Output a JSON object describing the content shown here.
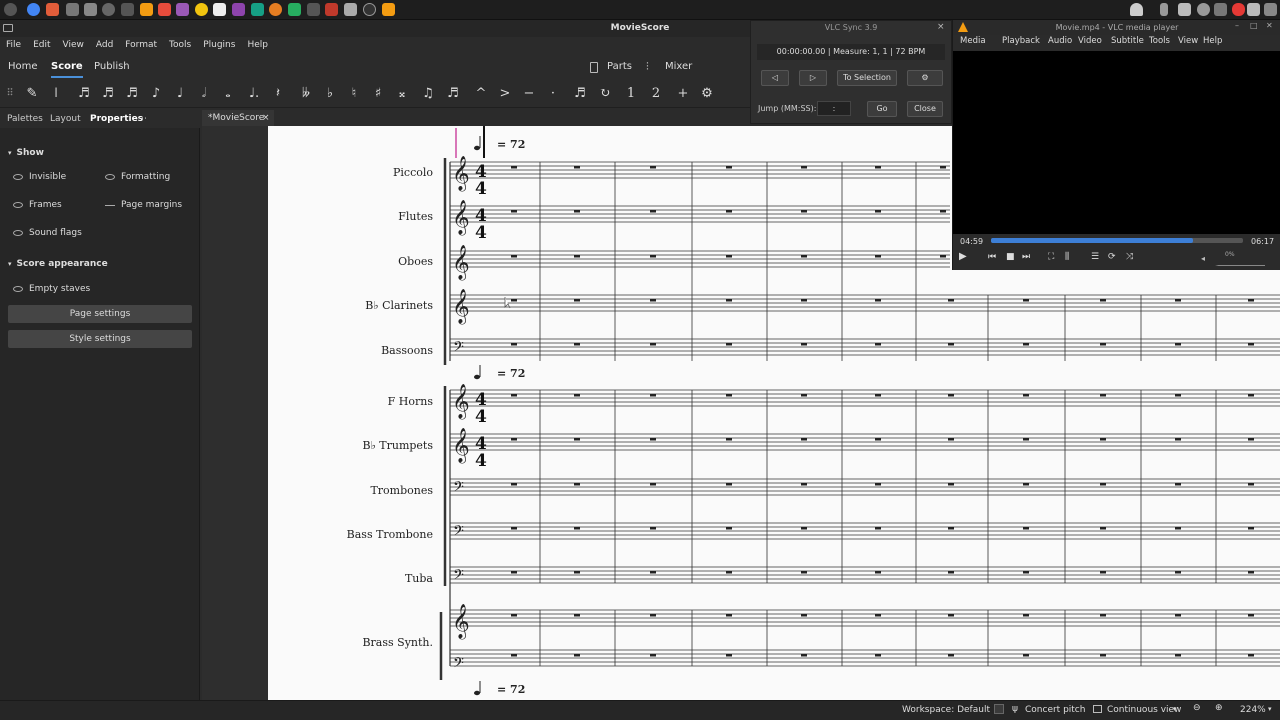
{
  "app": {
    "title": "MovieScore"
  },
  "menu": [
    "File",
    "Edit",
    "View",
    "Add",
    "Format",
    "Tools",
    "Plugins",
    "Help"
  ],
  "tabs": {
    "home": "Home",
    "score": "Score",
    "publish": "Publish",
    "parts": "Parts",
    "mixer": "Mixer"
  },
  "panel_tabs": {
    "palettes": "Palettes",
    "layout": "Layout",
    "properties": "Properties",
    "more": "⋯"
  },
  "properties": {
    "show_header": "Show",
    "invisible": "Invisible",
    "formatting": "Formatting",
    "frames": "Frames",
    "page_margins": "Page margins",
    "sound_flags": "Sound flags",
    "appearance_header": "Score appearance",
    "empty_staves": "Empty staves",
    "page_settings": "Page settings",
    "style_settings": "Style settings"
  },
  "document_tab": {
    "label": "*MovieScore",
    "close": "×"
  },
  "score": {
    "tempo_text": "= 72",
    "instruments": [
      "Piccolo",
      "Flutes",
      "Oboes",
      "B♭ Clarinets",
      "Bassoons",
      "F Horns",
      "B♭ Trumpets",
      "Trombones",
      "Bass Trombone",
      "Tuba",
      "Brass Synth."
    ]
  },
  "vlc_sync": {
    "title": "VLC Sync 3.9",
    "status": "00:00:00.00 | Measure: 1, 1 | 72 BPM",
    "to_selection": "To Selection",
    "jump_label": "Jump (MM:SS):",
    "jump_value": ":",
    "go": "Go",
    "close": "Close",
    "close_icon": "×"
  },
  "vlc_player": {
    "title": "Movie.mp4 - VLC media player",
    "menu": [
      "Media",
      "Playback",
      "Audio",
      "Video",
      "Subtitle",
      "Tools",
      "View",
      "Help"
    ],
    "time_current": "04:59",
    "time_total": "06:17",
    "progress": 0.8,
    "volume": "0%"
  },
  "status": {
    "workspace": "Workspace: Default",
    "concert_pitch": "Concert pitch",
    "view_mode": "Continuous view",
    "zoom": "224%"
  }
}
